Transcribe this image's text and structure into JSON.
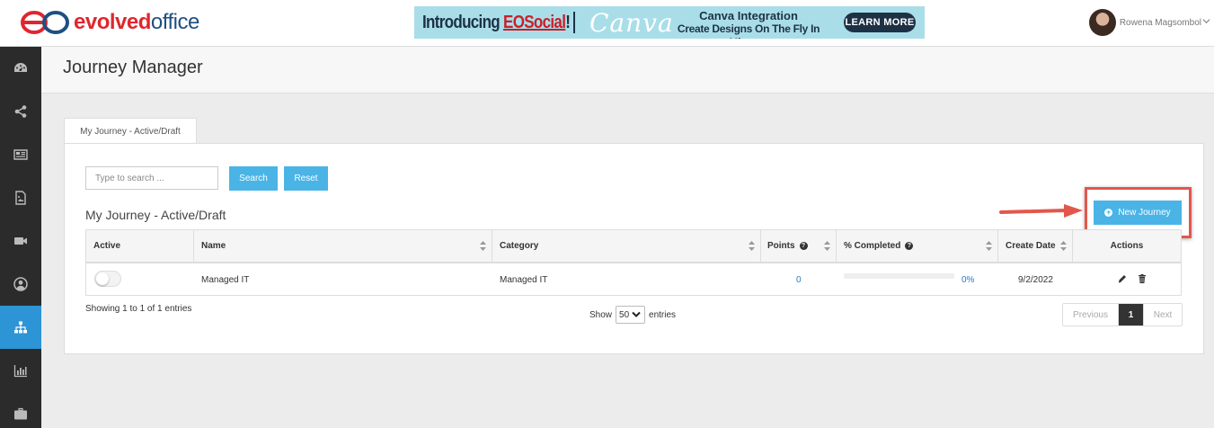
{
  "header": {
    "logo_part1": "evolved",
    "logo_part2": "office",
    "banner": {
      "intro_prefix": "Introducing ",
      "intro_brand": "EOSocial",
      "intro_suffix": "!",
      "canva": "Canva",
      "title": "Canva Integration",
      "subtitle": "Create Designs On The Fly In Minutes",
      "cta": "LEARN MORE",
      "bg_color": "#a9dee9"
    },
    "user_name": "Rowena Magsombol",
    "user_menu_icon": "chevron-down-icon"
  },
  "sidebar": {
    "items": [
      {
        "icon": "dashboard-icon",
        "active": false
      },
      {
        "icon": "share-icon",
        "active": false
      },
      {
        "icon": "newspaper-icon",
        "active": false
      },
      {
        "icon": "image-file-icon",
        "active": false
      },
      {
        "icon": "video-camera-icon",
        "active": false
      },
      {
        "icon": "user-circle-icon",
        "active": false
      },
      {
        "icon": "sitemap-icon",
        "active": true
      },
      {
        "icon": "bar-chart-icon",
        "active": false
      },
      {
        "icon": "briefcase-icon",
        "active": false
      }
    ],
    "active_color": "#2d95d6"
  },
  "page": {
    "title": "Journey Manager",
    "tab_label": "My Journey - Active/Draft",
    "search": {
      "placeholder": "Type to search ...",
      "search_label": "Search",
      "reset_label": "Reset"
    },
    "section_title": "My Journey - Active/Draft",
    "new_journey_label": "New Journey",
    "accent_color": "#4ab4e6",
    "highlight_color": "#e2574c"
  },
  "table": {
    "columns": [
      "Active",
      "Name",
      "Category",
      "Points",
      "% Completed",
      "Create Date",
      "Actions"
    ],
    "rows": [
      {
        "active": false,
        "name": "Managed IT",
        "category": "Managed IT",
        "points": "0",
        "completed_pct": 0,
        "completed_label": "0%",
        "create_date": "9/2/2022",
        "actions": [
          "pencil-icon",
          "trash-icon"
        ]
      }
    ]
  },
  "footer": {
    "info": "Showing 1 to 1 of 1 entries",
    "show_label": "Show",
    "page_size": "50",
    "entries_label": "entries",
    "pagination": {
      "previous": "Previous",
      "current": "1",
      "next": "Next"
    }
  }
}
